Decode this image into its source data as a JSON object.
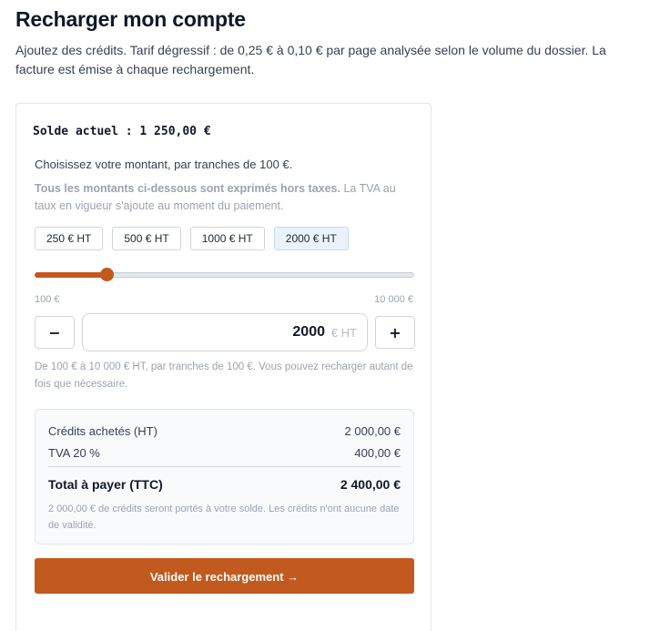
{
  "page": {
    "title": "Recharger mon compte",
    "intro": "Ajoutez des crédits. Tarif dégressif : de 0,25 € à 0,10 € par page analysée selon le volume du dossier. La facture est émise à chaque rechargement."
  },
  "card": {
    "balance": "Solde actuel : 1 250,00 €",
    "choose": "Choisissez votre montant, par tranches de 100 €.",
    "tax_note_bold": "Tous les montants ci-dessous sont exprimés hors taxes.",
    "tax_note_rest": " La TVA au taux en vigueur s'ajoute au moment du paiement.",
    "presets": [
      {
        "label": "250 € HT",
        "active": false
      },
      {
        "label": "500 € HT",
        "active": false
      },
      {
        "label": "1000 € HT",
        "active": false
      },
      {
        "label": "2000 € HT",
        "active": true
      }
    ],
    "slider": {
      "min": 100,
      "max": 10000,
      "value": 2000,
      "min_label": "100 €",
      "max_label": "10 000 €"
    },
    "stepper": {
      "minus_label": "−",
      "plus_label": "+",
      "value": "2000",
      "unit": "€ HT"
    },
    "help": "De 100 € à 10 000 € HT, par tranches de 100 €. Vous pouvez recharger autant de fois que nécessaire."
  },
  "summary": {
    "credits_label": "Crédits achetés (HT)",
    "credits_value": "2 000,00 €",
    "vat_label": "TVA 20 %",
    "vat_value": "400,00 €",
    "total_label": "Total à payer (TTC)",
    "total_value": "2 400,00 €",
    "note": "2 000,00 € de crédits seront portés à votre solde. Les crédits n'ont aucune date de validité."
  },
  "actions": {
    "validate_label": "Valider le rechargement →"
  },
  "colors": {
    "accent": "#c2591e",
    "preset_active_bg": "#eaf2fb",
    "summary_bg": "#f8fafc"
  }
}
